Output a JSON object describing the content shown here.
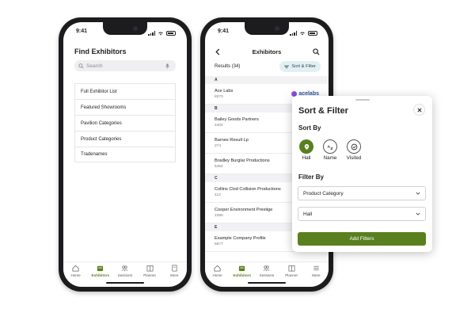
{
  "colors": {
    "accent": "#5a7f1f",
    "chip": "#e2eff3"
  },
  "phone1": {
    "time": "9:41",
    "title": "Find Exhibitors",
    "search_placeholder": "Search",
    "menu": [
      "Full Exhibitor List",
      "Featured Showrooms",
      "Pavilion Categories",
      "Product Categories",
      "Tradenames"
    ]
  },
  "phone2": {
    "time": "9:41",
    "title": "Exhibitors",
    "results": "Results (34)",
    "sort_filter": "Sort & Filter",
    "sections": [
      {
        "letter": "A",
        "rows": [
          {
            "name": "Ace Labs",
            "code": "8273",
            "logo": "acelabs"
          }
        ]
      },
      {
        "letter": "B",
        "rows": [
          {
            "name": "Bailey Goods Partners",
            "code": "4402"
          },
          {
            "name": "Barnes Result Lp",
            "code": "274"
          },
          {
            "name": "Bradley Burglar Productions",
            "code": "5462"
          }
        ]
      },
      {
        "letter": "C",
        "rows": [
          {
            "name": "Collins Clod Collision Productions",
            "code": "412"
          },
          {
            "name": "Cooper Environment Prestige",
            "code": "2390"
          }
        ]
      },
      {
        "letter": "E",
        "rows": [
          {
            "name": "Example Company Profile",
            "code": "6977"
          }
        ]
      }
    ]
  },
  "tabs": [
    "Home",
    "Exhibitors",
    "Sessions",
    "Planner",
    "More"
  ],
  "panel": {
    "title": "Sort & Filter",
    "sort_by": "Sort By",
    "sort_options": [
      "Hall",
      "Name",
      "Visited"
    ],
    "filter_by": "Filter By",
    "product_category": "Product Category",
    "hall": "Hall",
    "add_button": "Add Filters"
  }
}
